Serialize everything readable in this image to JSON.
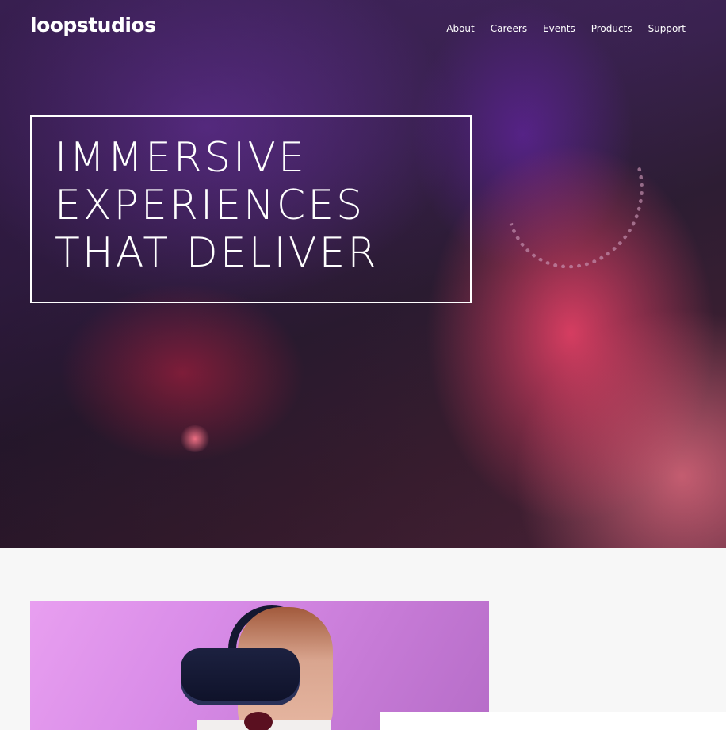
{
  "header": {
    "logo": "loopstudios",
    "nav": [
      "About",
      "Careers",
      "Events",
      "Products",
      "Support"
    ]
  },
  "hero": {
    "headline_lines": [
      "IMMERSIVE",
      "EXPERIENCES",
      "THAT DELIVER"
    ]
  },
  "colors": {
    "page_background": "#f7f7f7",
    "hero_text": "#ffffff",
    "box_border": "#ffffff"
  },
  "icons": []
}
